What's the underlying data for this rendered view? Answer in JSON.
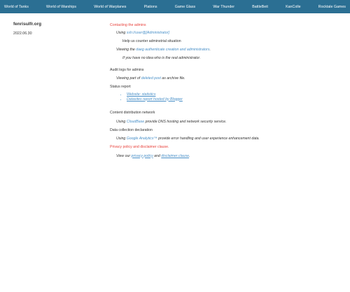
{
  "nav": {
    "items": [
      {
        "label": "World of Tanks"
      },
      {
        "label": "World of Warships"
      },
      {
        "label": "World of Warplanes"
      },
      {
        "label": "Plations"
      },
      {
        "label": "Game Glass"
      },
      {
        "label": "War Thunder"
      },
      {
        "label": "BattleBeit"
      },
      {
        "label": "KanColle"
      },
      {
        "label": "Rocktale Games"
      }
    ]
  },
  "sidebar": {
    "site_title": "fenrisulfr.org",
    "date": "2022.06.30"
  },
  "content": {
    "contacting": {
      "heading": "Contacting the admins",
      "using_prefix": "Using",
      "using_link": "ssh://user@[Administrator]",
      "help_text": "Help us counter adminstrial situation",
      "viewing_prefix": "Viewing the",
      "viewing_link": "daeg authenticate creation and administrators",
      "viewing_suffix": ".",
      "note": "If you have no idea who is the real administrator."
    },
    "audit": {
      "heading": "Audit logs for admins",
      "prefix": "Viewing part of",
      "link": "deleted post",
      "suffix": "as archive file."
    },
    "status": {
      "heading": "Status report",
      "items": [
        {
          "label": "Website: statistics"
        },
        {
          "label": "Datasites report hosted by Blogger"
        }
      ]
    },
    "cdn": {
      "heading": "Content distribution network",
      "prefix": "Using",
      "link": "CloudBase",
      "suffix": "provide DNS hosting and network security service."
    },
    "collection": {
      "heading": "Data collection declaration",
      "prefix": "Using",
      "link": "Google Analytics™",
      "suffix": "provide error handling and user experience enhancement data."
    },
    "privacy": {
      "heading": "Privacy policy and disclaimer clause.",
      "prefix": "View our",
      "link1": "privacy policy",
      "middle": "and",
      "link2": "disclaimer clause",
      "suffix": "."
    }
  },
  "colors": {
    "navbar": "#2b6f93",
    "accent_red": "#e8423c",
    "link": "#4a90c8"
  }
}
